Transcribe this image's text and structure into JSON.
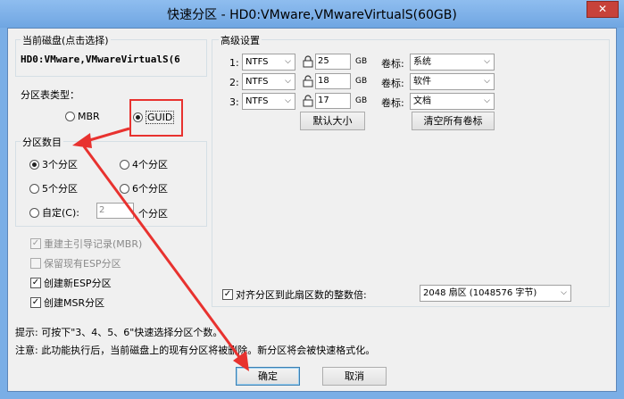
{
  "window": {
    "title": "快速分区 - HD0:VMware,VMwareVirtualS(60GB)",
    "close_glyph": "✕"
  },
  "current_disk": {
    "group_label": "当前磁盘(点击选择)",
    "value": "HD0:VMware,VMwareVirtualS(6"
  },
  "partition_table": {
    "label": "分区表类型：",
    "options": [
      "MBR",
      "GUID"
    ],
    "selected": "GUID"
  },
  "partition_count": {
    "group_label": "分区数目",
    "options": [
      "3个分区",
      "4个分区",
      "5个分区",
      "6个分区"
    ],
    "selected": "3个分区",
    "custom_label": "自定(C):",
    "custom_value": "2",
    "custom_suffix": "个分区"
  },
  "options": [
    {
      "label": "重建主引导记录(MBR)",
      "checked": true,
      "enabled": false
    },
    {
      "label": "保留现有ESP分区",
      "checked": false,
      "enabled": false
    },
    {
      "label": "创建新ESP分区",
      "checked": true,
      "enabled": true
    },
    {
      "label": "创建MSR分区",
      "checked": true,
      "enabled": true
    }
  ],
  "advanced": {
    "group_label": "高级设置",
    "rows": [
      {
        "index": "1:",
        "fs": "NTFS",
        "size": "25",
        "unit": "GB",
        "label_caption": "卷标:",
        "volume_label": "系统"
      },
      {
        "index": "2:",
        "fs": "NTFS",
        "size": "18",
        "unit": "GB",
        "label_caption": "卷标:",
        "volume_label": "软件"
      },
      {
        "index": "3:",
        "fs": "NTFS",
        "size": "17",
        "unit": "GB",
        "label_caption": "卷标:",
        "volume_label": "文档"
      }
    ],
    "default_size_button": "默认大小",
    "clear_labels_button": "清空所有卷标",
    "align_label": "对齐分区到此扇区数的整数倍:",
    "align_checked": true,
    "align_value": "2048 扇区 (1048576 字节)"
  },
  "hints": {
    "line1": "提示: 可按下\"3、4、5、6\"快速选择分区个数。",
    "line2": "注意: 此功能执行后，当前磁盘上的现有分区将被删除。新分区将会被快速格式化。"
  },
  "buttons": {
    "ok": "确定",
    "cancel": "取消"
  },
  "colors": {
    "annotation_red": "#e8322f",
    "title_bar": "#7aaee6"
  }
}
